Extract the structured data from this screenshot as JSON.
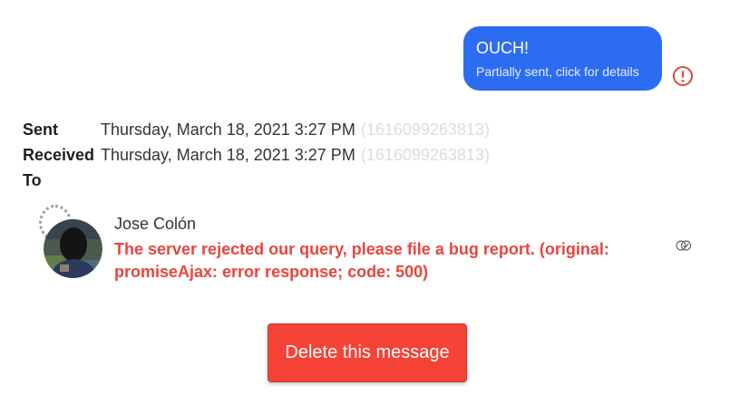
{
  "message": {
    "text": "OUCH!",
    "status": "Partially sent, click for details",
    "bubble_color": "#2c6cf0",
    "error_icon": "alert-circle-icon",
    "error_color": "#e8453c"
  },
  "meta": {
    "sent_label": "Sent",
    "sent_value": "Thursday, March 18, 2021 3:27 PM",
    "sent_timestamp": "(1616099263813)",
    "received_label": "Received",
    "received_value": "Thursday, March 18, 2021 3:27 PM",
    "received_timestamp": "(1616099263813)",
    "to_label": "To"
  },
  "recipient": {
    "name": "Jose Colón",
    "error": "The server rejected our query, please file a bug report. (original: promiseAjax: error response; code: 500)",
    "avatar": "user-avatar",
    "receipt_icon": "double-check-icon"
  },
  "actions": {
    "delete_label": "Delete this message",
    "delete_color": "#f44336"
  }
}
